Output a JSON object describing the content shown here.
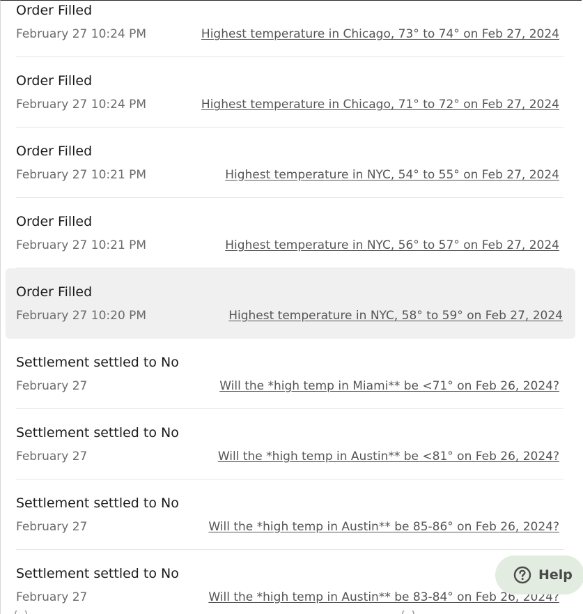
{
  "activity": [
    {
      "title": "Order Filled",
      "date": "February 27 10:24 PM",
      "market": "Highest temperature in Chicago, 73° to 74° on Feb 27, 2024"
    },
    {
      "title": "Order Filled",
      "date": "February 27 10:24 PM",
      "market": "Highest temperature in Chicago, 71° to 72° on Feb 27, 2024"
    },
    {
      "title": "Order Filled",
      "date": "February 27 10:21 PM",
      "market": "Highest temperature in NYC, 54° to 55° on Feb 27, 2024"
    },
    {
      "title": "Order Filled",
      "date": "February 27 10:21 PM",
      "market": "Highest temperature in NYC, 56° to 57° on Feb 27, 2024"
    },
    {
      "title": "Order Filled",
      "date": "February 27 10:20 PM",
      "market": "Highest temperature in NYC, 58° to 59° on Feb 27, 2024"
    },
    {
      "title": "Settlement settled to No",
      "date": "February 27",
      "market": "Will the *high temp in Miami** be <71° on Feb 26, 2024?"
    },
    {
      "title": "Settlement settled to No",
      "date": "February 27",
      "market": "Will the *high temp in Austin** be <81° on Feb 26, 2024?"
    },
    {
      "title": "Settlement settled to No",
      "date": "February 27",
      "market": "Will the *high temp in Austin** be 85-86° on Feb 26, 2024?"
    },
    {
      "title": "Settlement settled to No",
      "date": "February 27",
      "market": "Will the *high temp in Austin** be 83-84° on Feb 26, 2024?"
    }
  ],
  "highlighted_index": 4,
  "help": {
    "label": "Help",
    "icon": "question-circle-icon"
  },
  "colors": {
    "highlight_bg": "#f0f0f0",
    "help_bg": "#e3ece0",
    "link": "#555555",
    "muted": "#6b6b6b"
  }
}
